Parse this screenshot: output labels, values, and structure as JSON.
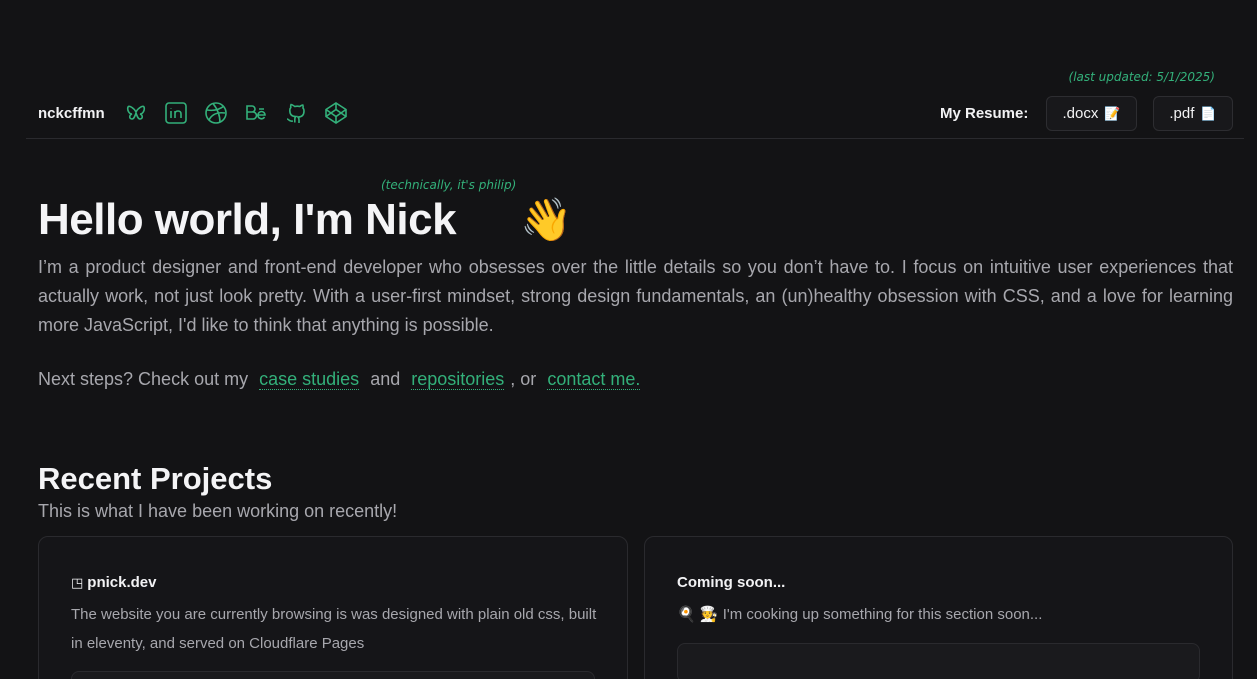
{
  "header": {
    "brand": "nckcffmn",
    "socials": [
      {
        "icon": "butterfly-icon"
      },
      {
        "icon": "linkedin-icon"
      },
      {
        "icon": "dribbble-icon"
      },
      {
        "icon": "behance-icon"
      },
      {
        "icon": "github-icon"
      },
      {
        "icon": "codepen-icon"
      }
    ],
    "last_updated": "(last updated: 5/1/2025)",
    "resume_label": "My Resume:",
    "resume_docx": ".docx",
    "resume_pdf": ".pdf"
  },
  "hero": {
    "aside_note": "(technically, it's philip)",
    "title": "Hello world, I'm Nick",
    "wave": "👋",
    "intro": "I’m a product designer and front-end developer who obsesses over the little details so you don’t have to. I focus on intuitive user experiences that actually work, not just look pretty. With a user-first mindset, strong design fundamentals, an (un)healthy obsession with CSS, and a love for learning more JavaScript, I'd like to think that anything is possible.",
    "next_prefix": "Next steps? Check out my",
    "link_case_studies": "case studies",
    "and_text": "and",
    "link_repositories": "repositories",
    "or_text": ", or",
    "link_contact": "contact me."
  },
  "projects": {
    "title": "Recent Projects",
    "subtitle": "This is what I have been working on recently!",
    "cards": [
      {
        "title": "pnick.dev",
        "icon": "external-link-icon",
        "description": "The website you are currently browsing is was designed with plain old css, built in eleventy, and served on Cloudflare Pages"
      },
      {
        "title": "Coming soon...",
        "description": "🍳 🧑‍🍳 I'm cooking up something for this section soon..."
      }
    ]
  },
  "colors": {
    "background": "#131315",
    "accent": "#33b07a",
    "text": "#f2f2f4",
    "muted": "#a7a7ad"
  }
}
